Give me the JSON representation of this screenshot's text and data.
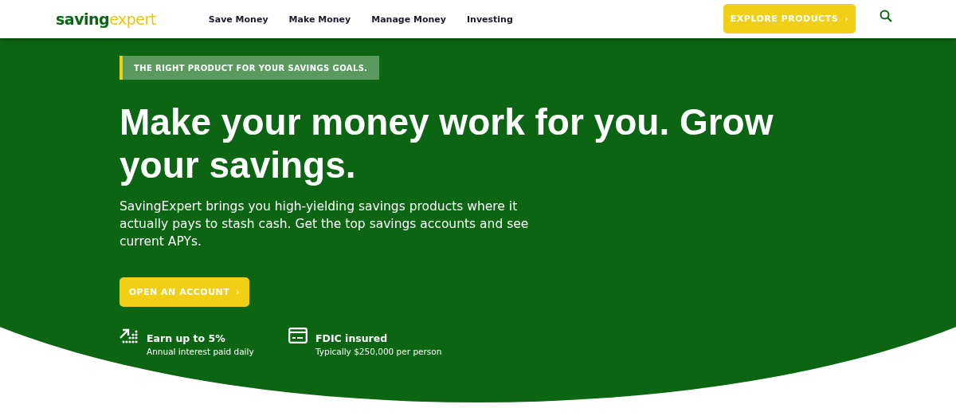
{
  "header": {
    "logo": {
      "first": "saving",
      "second": "expert"
    },
    "nav": [
      "Save Money",
      "Make Money",
      "Manage Money",
      "Investing"
    ],
    "cta": "EXPLORE PRODUCTS",
    "cta_chevron": "›"
  },
  "hero": {
    "eyebrow": "THE RIGHT PRODUCT FOR YOUR SAVINGS GOALS.",
    "headline": "Make your money work for you. Grow your savings.",
    "body": "SavingExpert brings you high-yielding savings products where it actually pays to stash cash. Get the top savings accounts and see current APYs.",
    "button": "OPEN AN ACCOUNT",
    "button_chevron": "›",
    "features": [
      {
        "kind": "growth",
        "title": "Earn up to 5%",
        "subtitle": "Annual interest paid daily"
      },
      {
        "kind": "card",
        "title": "FDIC insured",
        "subtitle": "Typically $250,000 per person"
      }
    ]
  }
}
